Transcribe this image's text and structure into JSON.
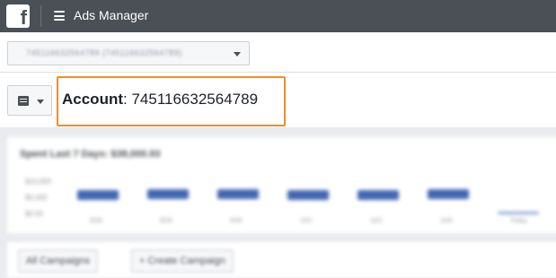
{
  "topbar": {
    "logo": "f",
    "title": "Ads Manager",
    "menu_icon": "hamburger-menu-icon"
  },
  "account_selector": {
    "value": "745116632564789 (745116632564789)"
  },
  "account_header": {
    "label": "Account",
    "separator": ":",
    "id": "745116632564789"
  },
  "spend_chart": {
    "title": "Spent Last 7 Days: $38,000.93",
    "y_ticks": [
      "$10,000",
      "$5,000",
      "$0.00"
    ],
    "x_ticks": [
      "9/28",
      "9/29",
      "9/30",
      "10/1",
      "10/2",
      "10/3",
      "Today"
    ]
  },
  "campaign_controls": {
    "all_campaigns_label": "All Campaigns",
    "create_campaign_label": "+ Create Campaign"
  },
  "colors": {
    "topbar": "#4b4f56",
    "highlight": "#f28c28",
    "bars": "#4267b2"
  },
  "chart_data": {
    "type": "bar",
    "categories": [
      "9/28",
      "9/29",
      "9/30",
      "10/1",
      "10/2",
      "10/3",
      "Today"
    ],
    "values": [
      5500,
      5800,
      5600,
      5400,
      5500,
      5600,
      700
    ],
    "title": "Spent Last 7 Days: $38,000.93",
    "xlabel": "",
    "ylabel": "",
    "ylim": [
      0,
      10000
    ]
  }
}
